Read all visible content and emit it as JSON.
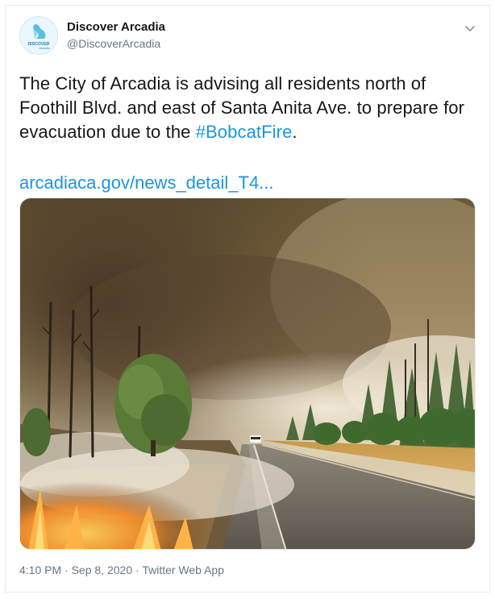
{
  "account": {
    "display_name": "Discover Arcadia",
    "handle": "@DiscoverArcadia",
    "avatar_text_top": "DISCOVER",
    "avatar_text_bottom": "Arcadia"
  },
  "tweet": {
    "text_before_hashtag": "The City of Arcadia is advising all residents north of Foothill Blvd. and east of Santa Anita Ave. to prepare for evacuation due to the ",
    "hashtag": "#BobcatFire",
    "text_after_hashtag": ".",
    "link": "arcadiaca.gov/news_detail_T4..."
  },
  "meta": {
    "time": "4:10 PM",
    "separator1": " · ",
    "date": "Sep 8, 2020",
    "separator2": " · ",
    "source": "Twitter Web App"
  },
  "icons": {
    "menu": "chevron-down-icon",
    "avatar": "swan-logo"
  },
  "colors": {
    "link": "#1b95e0",
    "secondary_text": "#657786",
    "border": "#e6ecf0"
  }
}
